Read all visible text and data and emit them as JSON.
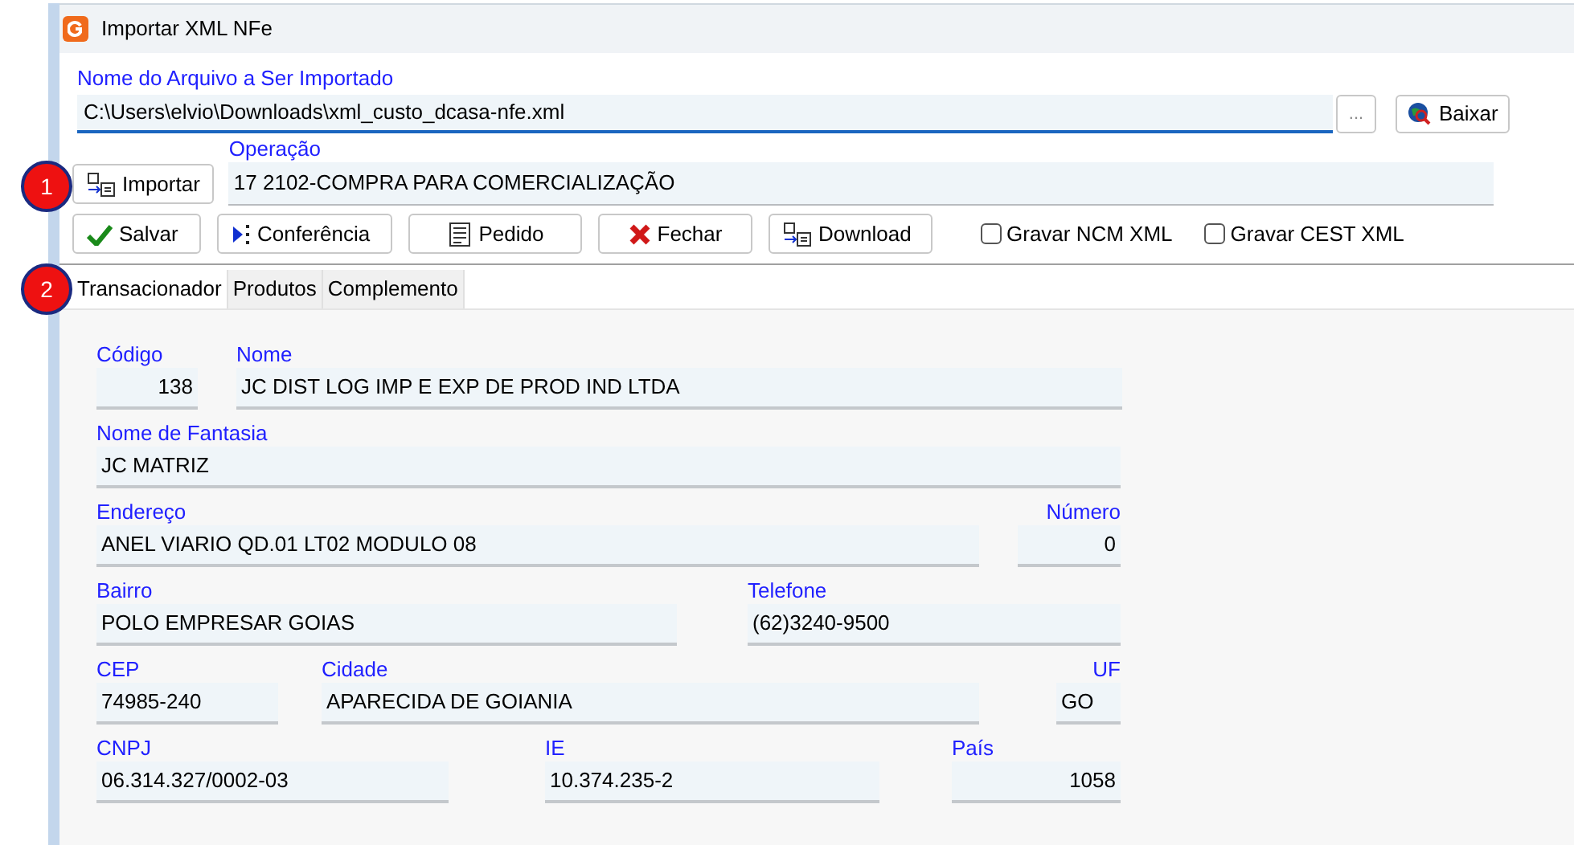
{
  "window": {
    "title": "Importar XML NFe"
  },
  "file": {
    "label": "Nome do Arquivo a Ser Importado",
    "value": "C:\\Users\\elvio\\Downloads\\xml_custo_dcasa-nfe.xml",
    "browse": "...",
    "download_button": "Baixar"
  },
  "import_button": "Importar",
  "operation": {
    "label": "Operação",
    "value": "17 2102-COMPRA PARA COMERCIALIZAÇÃO"
  },
  "actions": [
    {
      "kind": "check",
      "label": "Salvar"
    },
    {
      "kind": "play",
      "label": "Conferência"
    },
    {
      "kind": "doc",
      "label": "Pedido"
    },
    {
      "kind": "close",
      "label": "Fechar"
    },
    {
      "kind": "import",
      "label": "Download"
    }
  ],
  "options": [
    {
      "label": "Gravar NCM XML",
      "checked": false
    },
    {
      "label": "Gravar CEST XML",
      "checked": false
    }
  ],
  "tabs": [
    {
      "label": "Transacionador",
      "selected": true
    },
    {
      "label": "Produtos",
      "selected": false
    },
    {
      "label": "Complemento",
      "selected": false
    }
  ],
  "markers": [
    "1",
    "2"
  ],
  "form_rows": [
    [
      {
        "label": "Código",
        "value": "138",
        "kind": "number"
      },
      {
        "label": "Nome",
        "value": "JC DIST LOG IMP E EXP DE PROD IND LTDA",
        "kind": "text"
      }
    ],
    [
      {
        "label": "Nome de Fantasia",
        "value": "JC MATRIZ",
        "kind": "text"
      }
    ],
    [
      {
        "label": "Endereço",
        "value": "ANEL VIARIO QD.01 LT02 MODULO 08",
        "kind": "text"
      },
      {
        "label": "Número",
        "value": "0",
        "kind": "number"
      }
    ],
    [
      {
        "label": "Bairro",
        "value": "POLO EMPRESAR GOIAS",
        "kind": "text"
      },
      {
        "label": "Telefone",
        "value": "(62)3240-9500",
        "kind": "text"
      }
    ],
    [
      {
        "label": "CEP",
        "value": "74985-240",
        "kind": "text"
      },
      {
        "label": "Cidade",
        "value": "APARECIDA DE GOIANIA",
        "kind": "text"
      },
      {
        "label": "UF",
        "value": "GO",
        "kind": "text"
      }
    ],
    [
      {
        "label": "CNPJ",
        "value": "06.314.327/0002-03",
        "kind": "text"
      },
      {
        "label": "IE",
        "value": "10.374.235-2",
        "kind": "text"
      },
      {
        "label": "País",
        "value": "1058",
        "kind": "number"
      }
    ]
  ]
}
